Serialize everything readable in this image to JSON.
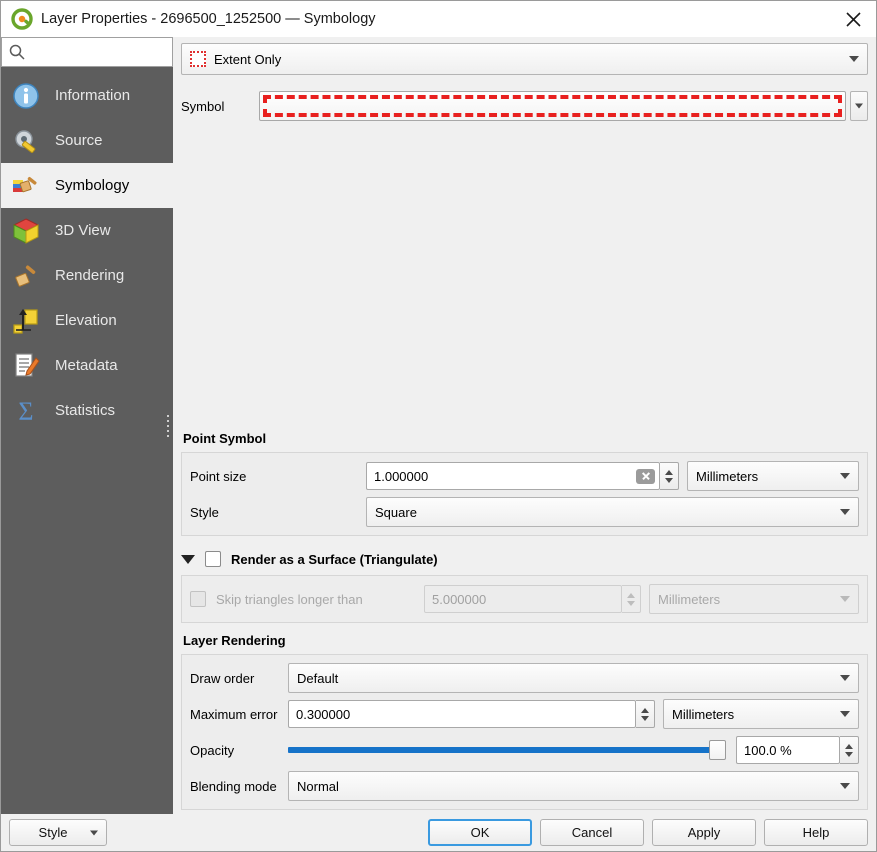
{
  "window": {
    "title": "Layer Properties - 2696500_1252500 — Symbology",
    "logo_icon": "qgis-logo-icon",
    "close_icon": "close-icon"
  },
  "sidebar": {
    "search": {
      "value": "",
      "placeholder": "",
      "icon": "search-icon"
    },
    "items": [
      {
        "label": "Information",
        "icon": "information-icon",
        "selected": false
      },
      {
        "label": "Source",
        "icon": "source-wrench-icon",
        "selected": false
      },
      {
        "label": "Symbology",
        "icon": "symbology-brush-icon",
        "selected": true
      },
      {
        "label": "3D View",
        "icon": "cube-3d-icon",
        "selected": false
      },
      {
        "label": "Rendering",
        "icon": "rendering-broom-icon",
        "selected": false
      },
      {
        "label": "Elevation",
        "icon": "elevation-arrow-icon",
        "selected": false
      },
      {
        "label": "Metadata",
        "icon": "metadata-pencil-icon",
        "selected": false
      },
      {
        "label": "Statistics",
        "icon": "statistics-sigma-icon",
        "selected": false
      }
    ]
  },
  "main": {
    "renderer": {
      "value": "Extent Only",
      "icon": "extent-only-icon"
    },
    "symbol": {
      "label": "Symbol",
      "preview_color": "#e8201f",
      "preview_style": "dashed",
      "dropdown_icon": "chevron-down-icon"
    },
    "point_symbol": {
      "title": "Point Symbol",
      "point_size": {
        "label": "Point size",
        "value": "1.000000",
        "unit": "Millimeters",
        "clear_icon": "clear-icon"
      },
      "style": {
        "label": "Style",
        "value": "Square"
      }
    },
    "triangulate": {
      "title": "Render as a Surface (Triangulate)",
      "checked": false,
      "expanded": true,
      "skip": {
        "label": "Skip triangles longer than",
        "checked": false,
        "value": "5.000000",
        "unit": "Millimeters",
        "enabled": false
      }
    },
    "layer_rendering": {
      "title": "Layer Rendering",
      "draw_order": {
        "label": "Draw order",
        "value": "Default"
      },
      "maximum_error": {
        "label": "Maximum error",
        "value": "0.300000",
        "unit": "Millimeters"
      },
      "opacity": {
        "label": "Opacity",
        "value": "100.0 %",
        "percent": 100,
        "track_color": "#1673c9"
      },
      "blending_mode": {
        "label": "Blending mode",
        "value": "Normal"
      }
    }
  },
  "footer": {
    "style": "Style",
    "ok": "OK",
    "cancel": "Cancel",
    "apply": "Apply",
    "help": "Help"
  }
}
